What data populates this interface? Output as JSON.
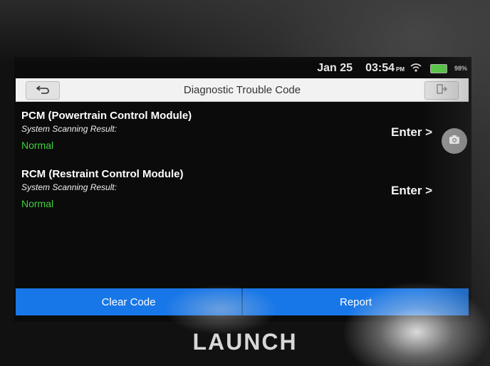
{
  "status": {
    "date": "Jan 25",
    "time": "03:54",
    "ampm": "PM",
    "battery": "98%"
  },
  "titlebar": {
    "title": "Diagnostic Trouble Code"
  },
  "modules": [
    {
      "name": "PCM (Powertrain Control Module)",
      "subtitle": "System Scanning Result:",
      "status": "Normal",
      "action": "Enter >"
    },
    {
      "name": "RCM (Restraint Control Module)",
      "subtitle": "System Scanning Result:",
      "status": "Normal",
      "action": "Enter >"
    }
  ],
  "bottom": {
    "clear_label": "Clear Code",
    "report_label": "Report"
  },
  "brand": "LAUNCH",
  "colors": {
    "accent": "#1877e8",
    "status_ok": "#3ed13e"
  },
  "icons": {
    "back": "back-arrow-icon",
    "exit": "exit-icon",
    "camera": "camera-icon",
    "wifi": "wifi-icon",
    "battery": "battery-icon"
  }
}
